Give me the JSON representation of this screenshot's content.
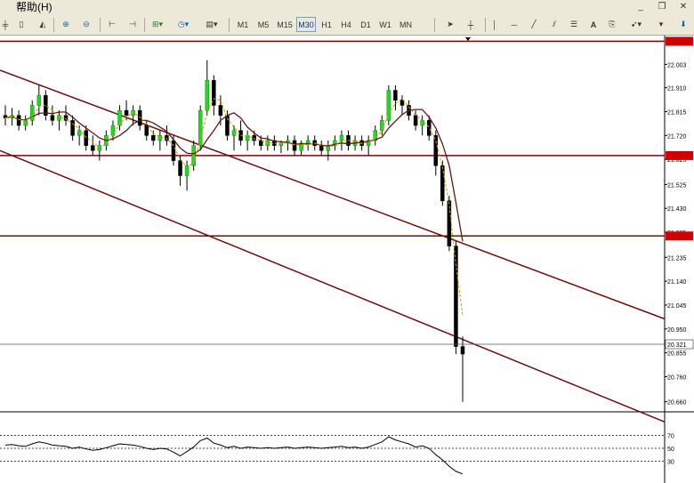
{
  "menu": {
    "help_label": "帮助(H)"
  },
  "toolbar": {
    "timeframes": [
      "M1",
      "M5",
      "M15",
      "M30",
      "H1",
      "H4",
      "D1",
      "W1",
      "MN"
    ],
    "selected_timeframe": "M30",
    "text_tool_label": "A"
  },
  "chart_data": {
    "type": "candlestick",
    "price_axis": {
      "ticks": [
        "22.003",
        "21.910",
        "21.815",
        "21.720",
        "21.625",
        "21.525",
        "21.430",
        "21.335",
        "21.235",
        "21.140",
        "21.045",
        "20.950",
        "20.855",
        "20.760",
        "20.660"
      ],
      "crosshair_label": "20.321"
    },
    "price_range": [
      20.62,
      22.1
    ],
    "horizontal_lines_price": [
      22.095,
      21.64,
      21.32
    ],
    "channel_lines_price": [
      [
        21.98,
        20.99
      ],
      [
        21.66,
        20.58
      ]
    ],
    "ohlc": [
      [
        21.8,
        21.84,
        21.76,
        21.79
      ],
      [
        21.79,
        21.83,
        21.76,
        21.8
      ],
      [
        21.8,
        21.82,
        21.74,
        21.76
      ],
      [
        21.76,
        21.8,
        21.74,
        21.78
      ],
      [
        21.78,
        21.86,
        21.76,
        21.84
      ],
      [
        21.84,
        21.92,
        21.8,
        21.88
      ],
      [
        21.88,
        21.9,
        21.78,
        21.8
      ],
      [
        21.8,
        21.84,
        21.76,
        21.78
      ],
      [
        21.78,
        21.82,
        21.74,
        21.8
      ],
      [
        21.8,
        21.84,
        21.76,
        21.78
      ],
      [
        21.78,
        21.8,
        21.7,
        21.72
      ],
      [
        21.72,
        21.76,
        21.68,
        21.74
      ],
      [
        21.74,
        21.76,
        21.66,
        21.68
      ],
      [
        21.68,
        21.72,
        21.64,
        21.66
      ],
      [
        21.66,
        21.7,
        21.62,
        21.68
      ],
      [
        21.68,
        21.74,
        21.66,
        21.72
      ],
      [
        21.72,
        21.78,
        21.7,
        21.76
      ],
      [
        21.76,
        21.84,
        21.74,
        21.82
      ],
      [
        21.82,
        21.86,
        21.78,
        21.8
      ],
      [
        21.8,
        21.84,
        21.76,
        21.82
      ],
      [
        21.82,
        21.84,
        21.74,
        21.76
      ],
      [
        21.76,
        21.78,
        21.7,
        21.72
      ],
      [
        21.72,
        21.74,
        21.68,
        21.7
      ],
      [
        21.7,
        21.74,
        21.66,
        21.72
      ],
      [
        21.72,
        21.76,
        21.68,
        21.7
      ],
      [
        21.7,
        21.72,
        21.6,
        21.62
      ],
      [
        21.62,
        21.64,
        21.52,
        21.56
      ],
      [
        21.56,
        21.62,
        21.5,
        21.6
      ],
      [
        21.6,
        21.7,
        21.58,
        21.68
      ],
      [
        21.68,
        21.84,
        21.66,
        21.82
      ],
      [
        21.82,
        22.02,
        21.8,
        21.94
      ],
      [
        21.94,
        21.96,
        21.8,
        21.84
      ],
      [
        21.84,
        21.88,
        21.76,
        21.8
      ],
      [
        21.8,
        21.82,
        21.7,
        21.72
      ],
      [
        21.72,
        21.76,
        21.66,
        21.74
      ],
      [
        21.74,
        21.78,
        21.68,
        21.7
      ],
      [
        21.7,
        21.74,
        21.66,
        21.72
      ],
      [
        21.72,
        21.74,
        21.68,
        21.7
      ],
      [
        21.7,
        21.72,
        21.66,
        21.68
      ],
      [
        21.68,
        21.72,
        21.66,
        21.7
      ],
      [
        21.7,
        21.72,
        21.66,
        21.68
      ],
      [
        21.68,
        21.7,
        21.65,
        21.69
      ],
      [
        21.69,
        21.72,
        21.66,
        21.7
      ],
      [
        21.7,
        21.72,
        21.64,
        21.66
      ],
      [
        21.66,
        21.7,
        21.64,
        21.69
      ],
      [
        21.69,
        21.72,
        21.66,
        21.7
      ],
      [
        21.7,
        21.72,
        21.66,
        21.68
      ],
      [
        21.68,
        21.7,
        21.64,
        21.66
      ],
      [
        21.66,
        21.7,
        21.62,
        21.68
      ],
      [
        21.68,
        21.72,
        21.66,
        21.7
      ],
      [
        21.7,
        21.74,
        21.66,
        21.72
      ],
      [
        21.72,
        21.74,
        21.66,
        21.68
      ],
      [
        21.68,
        21.72,
        21.66,
        21.7
      ],
      [
        21.7,
        21.72,
        21.66,
        21.68
      ],
      [
        21.68,
        21.72,
        21.64,
        21.7
      ],
      [
        21.7,
        21.76,
        21.68,
        21.74
      ],
      [
        21.74,
        21.8,
        21.72,
        21.78
      ],
      [
        21.78,
        21.92,
        21.76,
        21.9
      ],
      [
        21.9,
        21.92,
        21.82,
        21.86
      ],
      [
        21.86,
        21.88,
        21.8,
        21.84
      ],
      [
        21.84,
        21.86,
        21.78,
        21.8
      ],
      [
        21.8,
        21.82,
        21.74,
        21.76
      ],
      [
        21.76,
        21.8,
        21.72,
        21.78
      ],
      [
        21.78,
        21.8,
        21.7,
        21.72
      ],
      [
        21.72,
        21.74,
        21.56,
        21.6
      ],
      [
        21.6,
        21.62,
        21.44,
        21.46
      ],
      [
        21.46,
        21.48,
        21.26,
        21.28
      ],
      [
        21.28,
        21.3,
        20.85,
        20.88
      ],
      [
        20.88,
        20.92,
        20.66,
        20.85
      ]
    ],
    "indicator": {
      "levels": [
        "70",
        "50",
        "30"
      ],
      "series": [
        55,
        56,
        54,
        53,
        57,
        60,
        58,
        55,
        54,
        53,
        50,
        52,
        49,
        47,
        48,
        51,
        54,
        57,
        56,
        55,
        53,
        50,
        48,
        50,
        49,
        44,
        38,
        45,
        52,
        62,
        66,
        58,
        55,
        51,
        53,
        50,
        52,
        51,
        50,
        51,
        50,
        51,
        52,
        50,
        51,
        52,
        51,
        50,
        51,
        52,
        53,
        51,
        52,
        50,
        52,
        56,
        60,
        68,
        63,
        60,
        57,
        52,
        54,
        50,
        40,
        32,
        22,
        14,
        10
      ]
    }
  }
}
